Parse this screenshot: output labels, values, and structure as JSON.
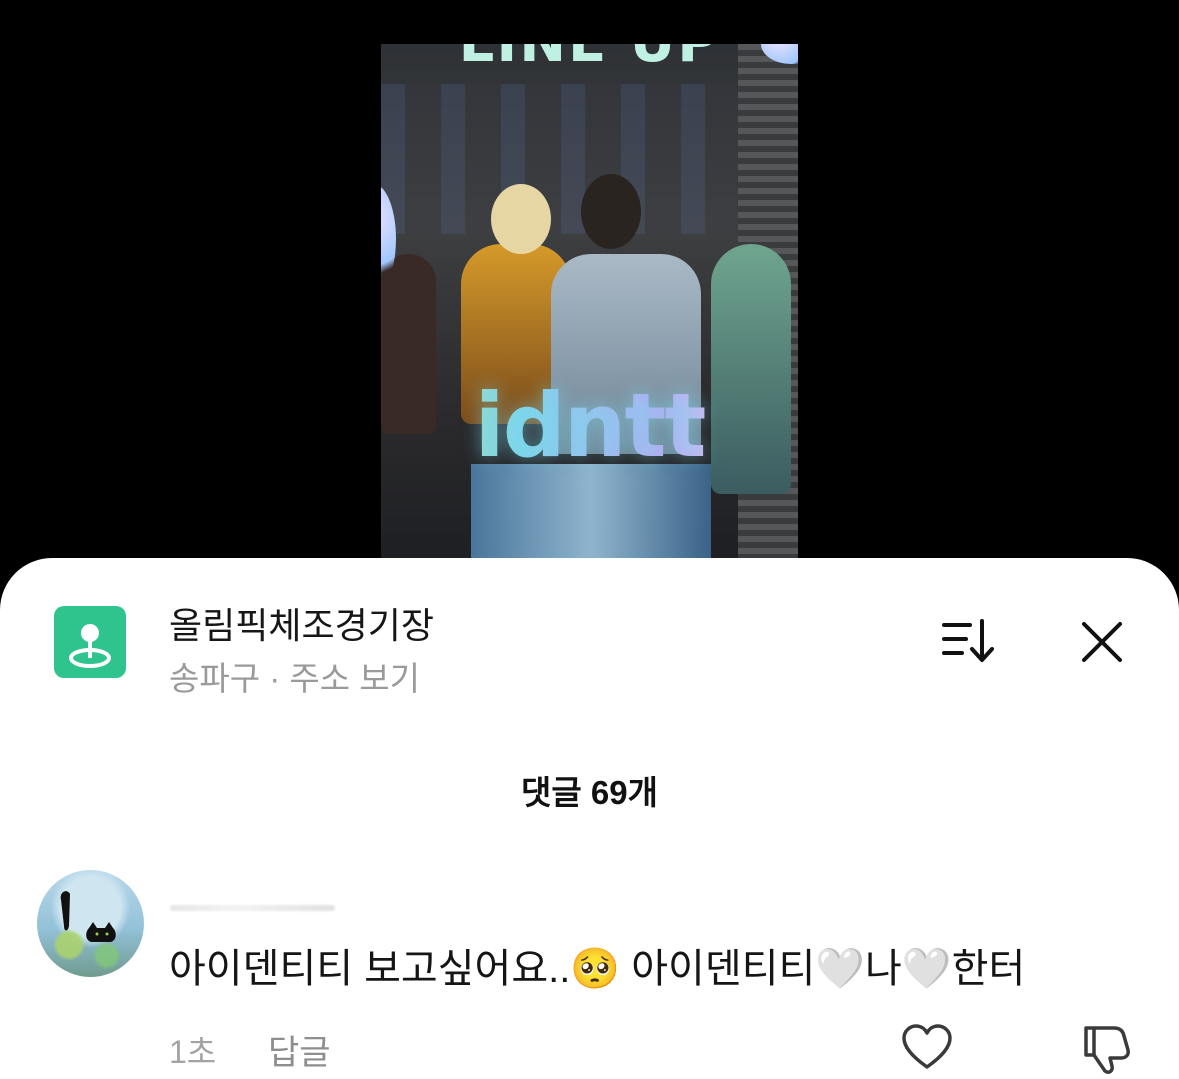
{
  "video": {
    "overlay_text": "idntt",
    "banner_text": "LINE UP"
  },
  "location": {
    "name": "올림픽체조경기장",
    "subtitle": "송파구 · 주소 보기",
    "icon": "map-pin-icon"
  },
  "header_actions": {
    "sort_icon": "sort-icon",
    "close_icon": "close-icon"
  },
  "comments": {
    "count_label": "댓글 69개",
    "items": [
      {
        "text": "아이덴티티 보고싶어요..🥺 아이덴티티🤍나🤍한터",
        "time": "1초",
        "reply_label": "답글",
        "like_icon": "heart-icon",
        "dislike_icon": "thumbs-down-icon"
      }
    ]
  },
  "colors": {
    "location_icon_bg": "#2fc48d",
    "sheet_bg": "#ffffff",
    "backdrop": "#000000"
  }
}
